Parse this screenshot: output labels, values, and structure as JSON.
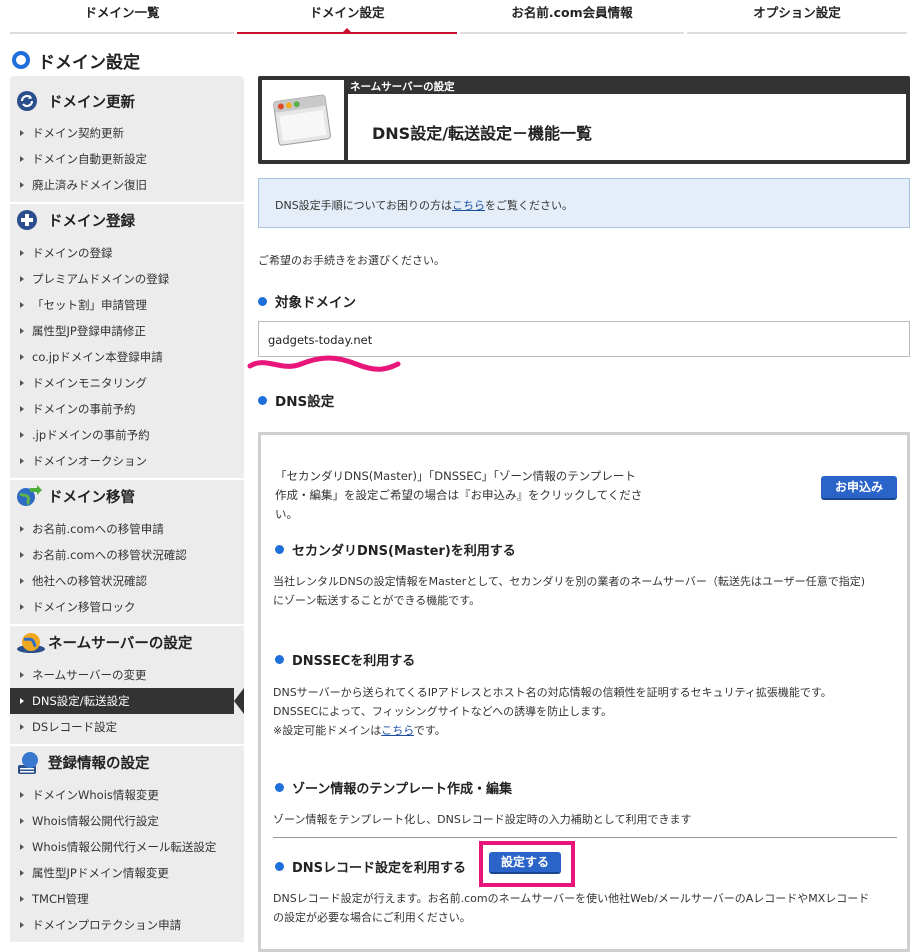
{
  "topnav": {
    "items": [
      {
        "label": "ドメイン一覧"
      },
      {
        "label": "ドメイン設定"
      },
      {
        "label": "お名前.com会員情報"
      },
      {
        "label": "オプション設定"
      }
    ]
  },
  "page_title": "ドメイン設定",
  "sidebar": {
    "sections": [
      {
        "title": "ドメイン更新",
        "icon": "refresh-icon",
        "items": [
          "ドメイン契約更新",
          "ドメイン自動更新設定",
          "廃止済みドメイン復旧"
        ]
      },
      {
        "title": "ドメイン登録",
        "icon": "plus-icon",
        "items": [
          "ドメインの登録",
          "プレミアムドメインの登録",
          "「セット割」申請管理",
          "属性型JP登録申請修正",
          "co.jpドメイン本登録申請",
          "ドメインモニタリング",
          "ドメインの事前予約",
          ".jpドメインの事前予約",
          "ドメインオークション"
        ]
      },
      {
        "title": "ドメイン移管",
        "icon": "transfer-globe-icon",
        "items": [
          "お名前.comへの移管申請",
          "お名前.comへの移管状況確認",
          "他社への移管状況確認",
          "ドメイン移管ロック"
        ]
      },
      {
        "title": "ネームサーバーの設定",
        "icon": "nameserver-globe-icon",
        "items": [
          "ネームサーバーの変更",
          "DNS設定/転送設定",
          "DSレコード設定"
        ]
      },
      {
        "title": "登録情報の設定",
        "icon": "registration-info-icon",
        "items": [
          "ドメインWhois情報変更",
          "Whois情報公開代行設定",
          "Whois情報公開代行メール転送設定",
          "属性型JPドメイン情報変更",
          "TMCH管理",
          "ドメインプロテクション申請"
        ]
      }
    ],
    "active_item": "DNS設定/転送設定"
  },
  "banner": {
    "subtitle": "ネームサーバーの設定",
    "title": "DNS設定/転送設定－機能一覧"
  },
  "help": {
    "before": "DNS設定手順についてお困りの方は",
    "link": "こちら",
    "after": "をご覧ください。"
  },
  "prompt": "ご希望のお手続きをお選びください。",
  "target_domain": {
    "heading": "対象ドメイン",
    "value": "gadgets-today.net"
  },
  "dns": {
    "heading": "DNS設定",
    "apply_text_1": "「セカンダリDNS(Master)」「DNSSEC」「ゾーン情報のテンプレート",
    "apply_text_2": "作成・編集」を設定ご希望の場合は『お申込み』をクリックしてくださ",
    "apply_text_3": "い。",
    "apply_button": "お申込み",
    "secondary": {
      "heading": "セカンダリDNS(Master)を利用する",
      "text_1": "当社レンタルDNSの設定情報をMasterとして、セカンダリを別の業者のネームサーバー（転送先はユーザー任意で指定)",
      "text_2": "にゾーン転送することができる機能です。"
    },
    "dnssec": {
      "heading": "DNSSECを利用する",
      "text_1": "DNSサーバーから送られてくるIPアドレスとホスト名の対応情報の信頼性を証明するセキュリティ拡張機能です。",
      "text_2": "DNSSECによって、フィッシングサイトなどへの誘導を防止します。",
      "text_3_before": "※設定可能ドメインは",
      "text_3_link": "こちら",
      "text_3_after": "です。"
    },
    "zone": {
      "heading": "ゾーン情報のテンプレート作成・編集",
      "text_1": "ゾーン情報をテンプレート化し、DNSレコード設定時の入力補助として利用できます"
    },
    "record": {
      "heading": "DNSレコード設定を利用する",
      "button": "設定する",
      "text_1": "DNSレコード設定が行えます。お名前.comのネームサーバーを使い他社Web/メールサーバーのAレコードやMXレコード",
      "text_2": "の設定が必要な場合にご利用ください。"
    }
  },
  "colors": {
    "accent_red": "#c8102e",
    "link_blue": "#1a4fa0",
    "button_blue": "#2a64c8",
    "highlight_pink": "#e8157a",
    "help_bg": "#e5eef8"
  }
}
